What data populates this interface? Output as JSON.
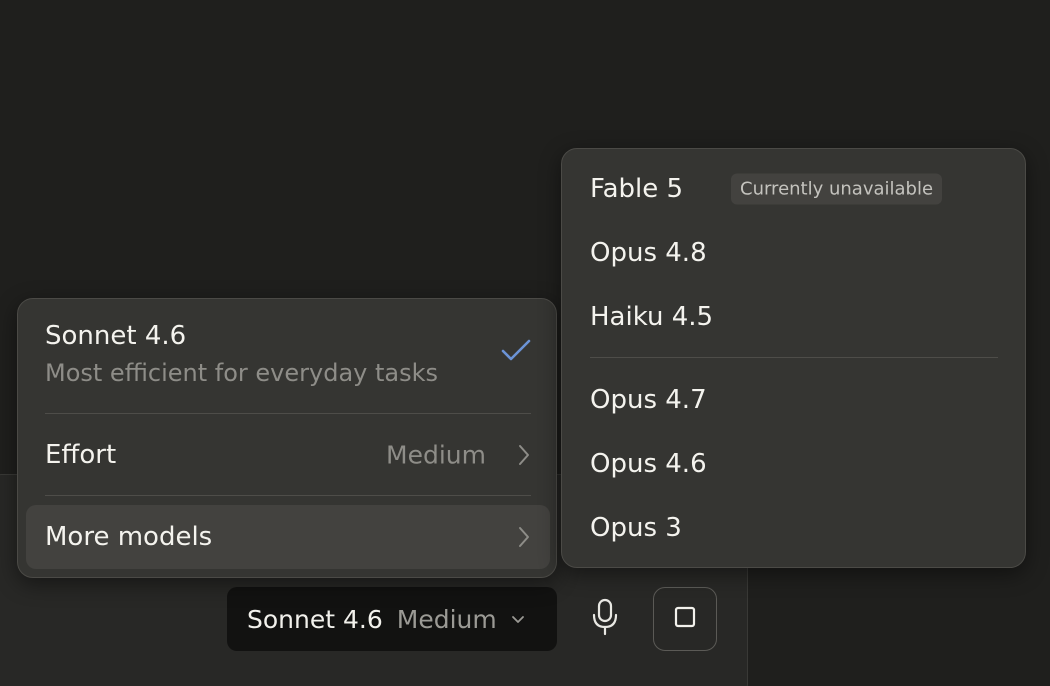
{
  "composer": {
    "model_selector": {
      "model": "Sonnet 4.6",
      "effort": "Medium"
    }
  },
  "main_menu": {
    "current": {
      "title": "Sonnet 4.6",
      "description": "Most efficient for everyday tasks"
    },
    "effort": {
      "label": "Effort",
      "value": "Medium"
    },
    "more_models": {
      "label": "More models"
    }
  },
  "sub_menu": {
    "featured": [
      {
        "label": "Fable 5",
        "badge": "Currently unavailable"
      },
      {
        "label": "Opus 4.8"
      },
      {
        "label": "Haiku 4.5"
      }
    ],
    "legacy": [
      {
        "label": "Opus 4.7"
      },
      {
        "label": "Opus 4.6"
      },
      {
        "label": "Opus 3"
      }
    ]
  },
  "colors": {
    "background": "#1f1f1d",
    "menu": "#353532",
    "check_accent": "#6b93d6"
  },
  "icons": [
    "check-icon",
    "chevron-right-icon",
    "chevron-down-icon",
    "microphone-icon",
    "stop-icon"
  ]
}
